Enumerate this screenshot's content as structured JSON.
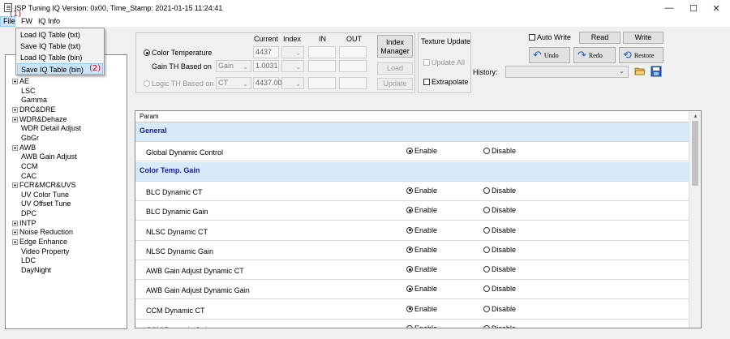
{
  "window": {
    "title": "ISP Tuning IQ Version: 0x00, Time_Stamp: 2021-01-15 11:24:41",
    "minimize": "—",
    "maximize": "☐",
    "close": "✕"
  },
  "menu": {
    "file": "File",
    "fw": "FW",
    "iq_info": "IQ Info"
  },
  "annotations": {
    "a1": "(1)",
    "a2": "(2)"
  },
  "file_menu": [
    "Load IQ Table (txt)",
    "Save IQ Table (txt)",
    "Load IQ Table (bin)",
    "Save IQ Table (bin)"
  ],
  "tree": [
    {
      "label": "AE",
      "expand": true
    },
    {
      "label": "LSC",
      "expand": false
    },
    {
      "label": "Gamma",
      "expand": false
    },
    {
      "label": "DRC&DRE",
      "expand": true
    },
    {
      "label": "WDR&Dehaze",
      "expand": true
    },
    {
      "label": "WDR Detail Adjust",
      "expand": false
    },
    {
      "label": "GbGr",
      "expand": false
    },
    {
      "label": "AWB",
      "expand": true
    },
    {
      "label": "AWB Gain Adjust",
      "expand": false
    },
    {
      "label": "CCM",
      "expand": false
    },
    {
      "label": "CAC",
      "expand": false
    },
    {
      "label": "FCR&MCR&UVS",
      "expand": true
    },
    {
      "label": "UV Color Tune",
      "expand": false
    },
    {
      "label": "UV Offset Tune",
      "expand": false
    },
    {
      "label": "DPC",
      "expand": false
    },
    {
      "label": "INTP",
      "expand": true
    },
    {
      "label": "Noise Reduction",
      "expand": true
    },
    {
      "label": "Edge Enhance",
      "expand": true
    },
    {
      "label": "Video Property",
      "expand": false
    },
    {
      "label": "LDC",
      "expand": false
    },
    {
      "label": "DayNight",
      "expand": false
    }
  ],
  "cfg": {
    "h_current": "Current",
    "h_index": "Index",
    "h_in": "IN",
    "h_out": "OUT",
    "color_temp": "Color Temperature",
    "color_temp_current": "4437",
    "gain_th_label": "Gain TH Based on",
    "gain_sel": "Gain",
    "gain_current": "1.0031",
    "logic_th": "Logic TH Based on",
    "ct_sel": "CT",
    "ct_current": "4437.00",
    "index_manager": "Index Manager",
    "load": "Load",
    "update": "Update"
  },
  "texture": {
    "title": "Texture Update",
    "update_all": "Update All",
    "extrapolate": "Extrapolate"
  },
  "tools": {
    "auto_write": "Auto Write",
    "read": "Read",
    "write": "Write",
    "undo": "Undo",
    "redo": "Redo",
    "restore": "Restore",
    "history": "History:"
  },
  "grid": {
    "header": "Param",
    "enable": "Enable",
    "disable": "Disable",
    "rows": [
      {
        "type": "section",
        "label": "General"
      },
      {
        "type": "param",
        "label": "Global Dynamic Control",
        "value": "enable"
      },
      {
        "type": "section",
        "label": "Color Temp.  Gain"
      },
      {
        "type": "param",
        "label": "BLC Dynamic CT",
        "value": "enable"
      },
      {
        "type": "param",
        "label": "BLC Dynamic Gain",
        "value": "enable"
      },
      {
        "type": "param",
        "label": "NLSC Dynamic CT",
        "value": "enable"
      },
      {
        "type": "param",
        "label": "NLSC Dynamic Gain",
        "value": "enable"
      },
      {
        "type": "param",
        "label": "AWB Gain Adjust Dynamic CT",
        "value": "enable"
      },
      {
        "type": "param",
        "label": "AWB Gain Adjust Dynamic Gain",
        "value": "enable"
      },
      {
        "type": "param",
        "label": "CCM Dynamic CT",
        "value": "enable"
      },
      {
        "type": "param",
        "label": "CCM Dynamic Gain",
        "value": "enable"
      }
    ]
  }
}
